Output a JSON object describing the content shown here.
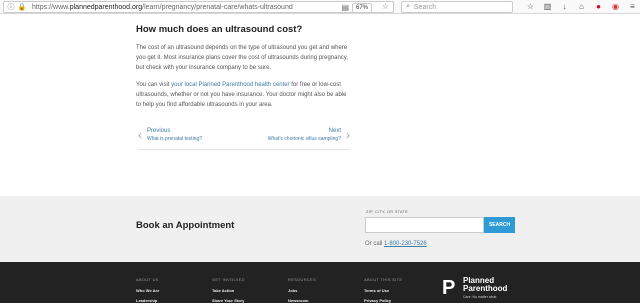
{
  "browser": {
    "url_prefix": "https://www.",
    "url_domain": "plannedparenthood.org",
    "url_path": "/learn/pregnancy/prenatal-care/whats-ultrasound",
    "zoom": "67%",
    "search_placeholder": "Search"
  },
  "article": {
    "heading": "How much does an ultrasound cost?",
    "para1": "The cost of an ultrasound depends on the type of ultrasound you get and where you get it. Most insurance plans cover the cost of ultrasounds during pregnancy, but check with your insurance company to be sure.",
    "para2_pre": "You can visit ",
    "para2_link": "your local Planned Parenthood health center",
    "para2_post": " for free or low-cost ultrasounds, whether or not you have insurance. Your doctor might also be able to help you find affordable ultrasounds in your area."
  },
  "pager": {
    "prev_label": "Previous",
    "prev_title": "What is prenatal testing?",
    "next_label": "Next",
    "next_title": "What's chorionic villus sampling?"
  },
  "booking": {
    "title": "Book an Appointment",
    "field_label": "ZIP, CITY, OR STATE",
    "button": "SEARCH",
    "call_pre": "Or call ",
    "phone": "1-800-230-7526"
  },
  "footer": {
    "columns": [
      {
        "heading": "ABOUT US",
        "items": [
          "Who We Are",
          "Leadership"
        ]
      },
      {
        "heading": "GET INVOLVED",
        "items": [
          "Take Action",
          "Share Your Story"
        ]
      },
      {
        "heading": "RESOURCES",
        "items": [
          "Jobs",
          "Newsroom"
        ]
      },
      {
        "heading": "ABOUT THIS SITE",
        "items": [
          "Terms of Use",
          "Privacy Policy"
        ]
      }
    ],
    "logo_line1": "Planned",
    "logo_line2": "Parenthood",
    "logo_tag": "Care. No matter what."
  }
}
